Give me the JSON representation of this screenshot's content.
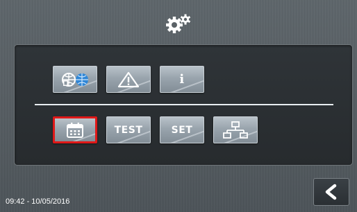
{
  "header": {
    "icon": "gears-icon"
  },
  "top_row": [
    {
      "name": "language-button",
      "icon": "language-globe-icon"
    },
    {
      "name": "alarms-button",
      "icon": "warning-icon"
    },
    {
      "name": "info-button",
      "label": "i"
    }
  ],
  "bottom_row": [
    {
      "name": "calendar-button",
      "icon": "calendar-icon",
      "selected": true
    },
    {
      "name": "test-button",
      "label": "TEST"
    },
    {
      "name": "set-button",
      "label": "SET"
    },
    {
      "name": "network-button",
      "icon": "network-icon"
    }
  ],
  "status_bar": {
    "datetime": "09:42 - 10/05/2016"
  },
  "back_button": {
    "icon": "back-arrow-icon"
  },
  "colors": {
    "background": "#575e63",
    "panel": "#2b2f32",
    "button": "#9aa5ae",
    "selected_border": "#e01818",
    "globe": "#2f86d6"
  }
}
